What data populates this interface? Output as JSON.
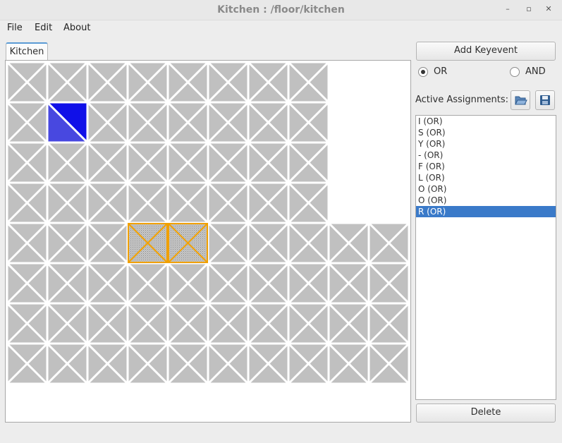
{
  "window": {
    "title": "Kitchen : /floor/kitchen",
    "minimize": "–",
    "maximize": "▫",
    "close": "✕"
  },
  "menu": [
    "File",
    "Edit",
    "About"
  ],
  "tab": {
    "label": "Kitchen"
  },
  "grid": {
    "rows": [
      [
        1,
        1,
        1,
        1,
        1,
        1,
        1,
        1,
        0,
        0
      ],
      [
        1,
        1,
        1,
        1,
        1,
        1,
        1,
        1,
        0,
        0
      ],
      [
        1,
        1,
        1,
        1,
        1,
        1,
        1,
        1,
        0,
        0
      ],
      [
        1,
        1,
        1,
        1,
        1,
        1,
        1,
        1,
        0,
        0
      ],
      [
        1,
        1,
        1,
        1,
        1,
        1,
        1,
        1,
        1,
        1
      ],
      [
        1,
        1,
        1,
        1,
        1,
        1,
        1,
        1,
        1,
        1
      ],
      [
        1,
        1,
        1,
        1,
        1,
        1,
        1,
        1,
        1,
        1
      ],
      [
        1,
        1,
        1,
        1,
        1,
        1,
        1,
        1,
        1,
        1
      ]
    ],
    "active_cell": {
      "row": 1,
      "col": 1
    },
    "selected_cells": [
      {
        "row": 4,
        "col": 3
      },
      {
        "row": 4,
        "col": 4
      }
    ],
    "colors": {
      "tile": "#c0c0c0",
      "line": "#ffffff",
      "active_dark": "#1010e8",
      "active_light": "#4848e0",
      "selection": "#f0a000"
    }
  },
  "panel": {
    "add_button": "Add Keyevent",
    "radio_or": "OR",
    "radio_and": "AND",
    "selected_mode": "OR",
    "assignments_label": "Active Assignments:",
    "open_icon": "folder-open-icon",
    "save_icon": "save-icon",
    "assignments": [
      "I (OR)",
      "S (OR)",
      "Y (OR)",
      "- (OR)",
      "F (OR)",
      "L (OR)",
      "O (OR)",
      "O (OR)",
      "R (OR)"
    ],
    "selected_index": 8,
    "delete_button": "Delete"
  }
}
